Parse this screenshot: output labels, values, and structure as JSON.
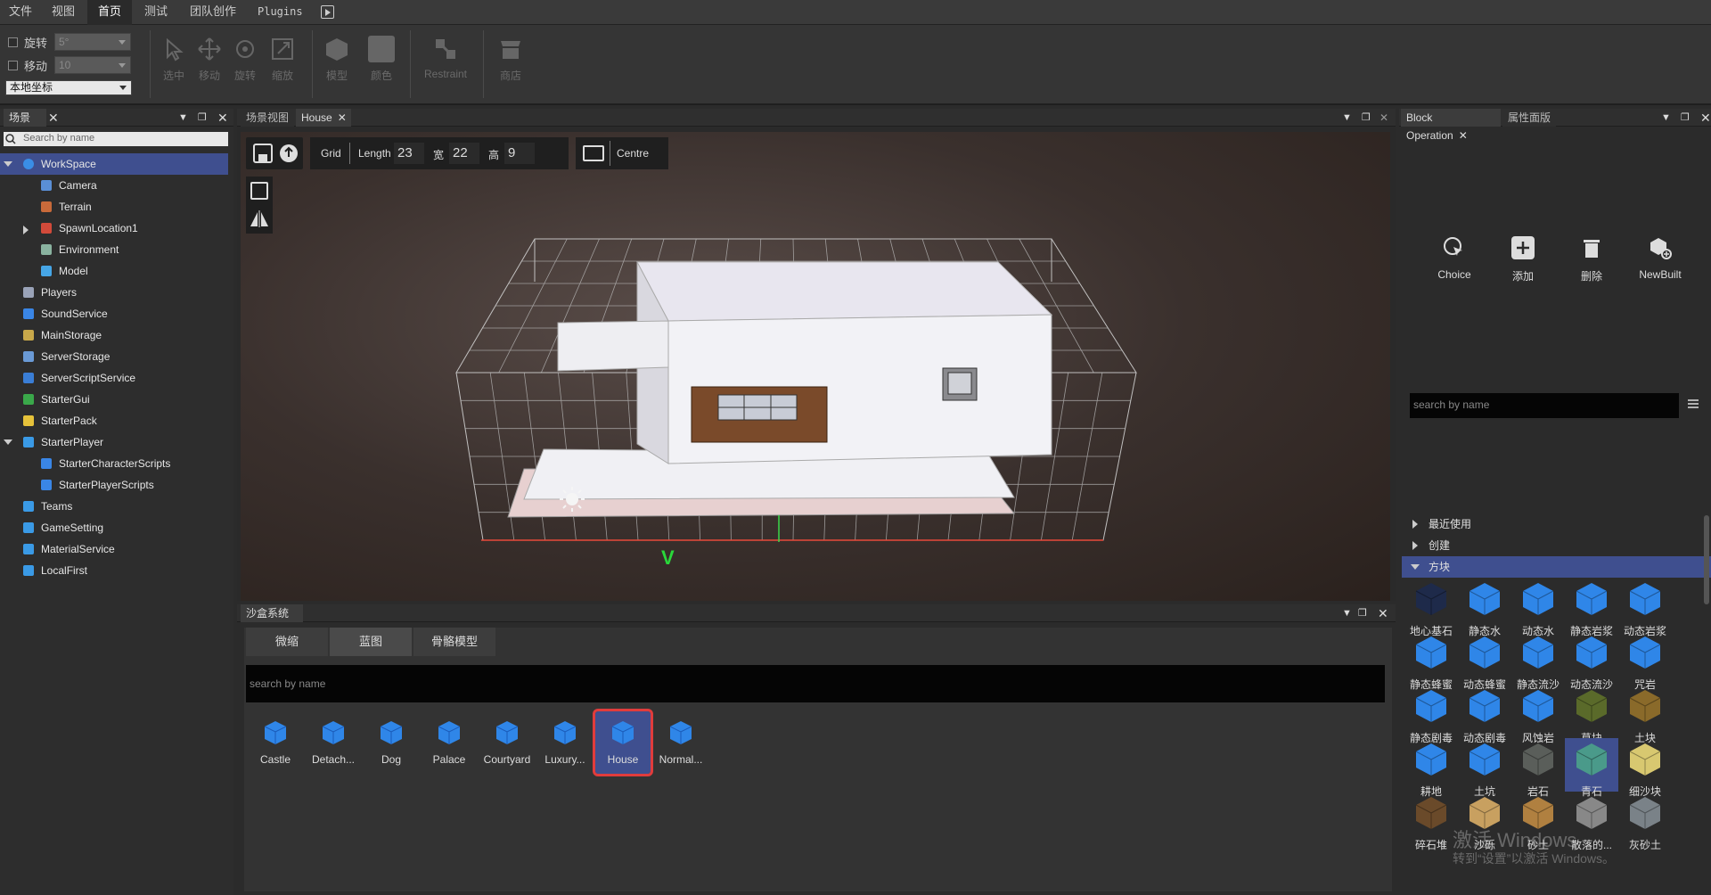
{
  "menubar": {
    "items": [
      "文件",
      "视图",
      "首页",
      "测试",
      "团队创作",
      "Plugins"
    ],
    "active_index": 2
  },
  "toolbar": {
    "rotate_label": "旋转",
    "rotate_value": "5°",
    "move_label": "移动",
    "move_value": "10",
    "coord_mode": "本地坐标",
    "buttons": [
      "选中",
      "移动",
      "旋转",
      "缩放",
      "模型",
      "颜色",
      "Restraint",
      "商店"
    ]
  },
  "scene_panel": {
    "tab_label": "场景",
    "search_placeholder": "Search by name",
    "tree": [
      {
        "label": "WorkSpace",
        "icon": "globe-icon",
        "color": "#3a8ee6",
        "selected": true,
        "expanded": true
      },
      {
        "label": "Camera",
        "icon": "camera-icon",
        "color": "#5a8fd6"
      },
      {
        "label": "Terrain",
        "icon": "terrain-icon",
        "color": "#c86a3a"
      },
      {
        "label": "SpawnLocation1",
        "icon": "spawn-icon",
        "color": "#d24a3a",
        "collapsed": true
      },
      {
        "label": "Environment",
        "icon": "environment-icon",
        "color": "#8ab3a0"
      },
      {
        "label": "Model",
        "icon": "model-icon",
        "color": "#46a6e6"
      },
      {
        "label": "Players",
        "icon": "players-icon",
        "color": "#9aa3b8"
      },
      {
        "label": "SoundService",
        "icon": "sound-icon",
        "color": "#3a86e6"
      },
      {
        "label": "MainStorage",
        "icon": "storage-icon",
        "color": "#c8a84a"
      },
      {
        "label": "ServerStorage",
        "icon": "server-storage-icon",
        "color": "#6a9ad6"
      },
      {
        "label": "ServerScriptService",
        "icon": "script-service-icon",
        "color": "#3a7ed6"
      },
      {
        "label": "StarterGui",
        "icon": "gui-icon",
        "color": "#3aa84a"
      },
      {
        "label": "StarterPack",
        "icon": "pack-icon",
        "color": "#e6c23a"
      },
      {
        "label": "StarterPlayer",
        "icon": "player-icon",
        "color": "#3a9ae6",
        "expanded": true
      },
      {
        "label": "StarterCharacterScripts",
        "icon": "character-scripts-icon",
        "color": "#3a86e6"
      },
      {
        "label": "StarterPlayerScripts",
        "icon": "player-scripts-icon",
        "color": "#3a86e6"
      },
      {
        "label": "Teams",
        "icon": "teams-icon",
        "color": "#3a9ae6"
      },
      {
        "label": "GameSetting",
        "icon": "settings-icon",
        "color": "#3a9ae6"
      },
      {
        "label": "MaterialService",
        "icon": "material-icon",
        "color": "#3a9ae6"
      },
      {
        "label": "LocalFirst",
        "icon": "local-icon",
        "color": "#3a9ae6"
      }
    ]
  },
  "editor": {
    "tabs": [
      "场景视图",
      "House"
    ],
    "grid_label": "Grid",
    "length_label": "Length",
    "length_value": "23",
    "width_label": "宽",
    "width_value": "22",
    "height_label": "高",
    "height_value": "9",
    "centre_label": "Centre",
    "axis_marker": "V"
  },
  "sandbox": {
    "tab_label": "沙盒系统",
    "subtabs": [
      "微缩",
      "蓝图",
      "骨骼模型"
    ],
    "search_placeholder": "search by name",
    "assets": [
      "Castle",
      "Detach...",
      "Dog",
      "Palace",
      "Courtyard",
      "Luxury...",
      "House",
      "Normal..."
    ],
    "selected_asset": "House"
  },
  "block_panel": {
    "tabs": [
      "Block Operation",
      "属性面版"
    ],
    "operations": [
      "Choice",
      "添加",
      "删除",
      "NewBuilt"
    ],
    "search_placeholder": "search by name",
    "categories": [
      "最近使用",
      "创建",
      "方块"
    ],
    "blocks": [
      {
        "label": "地心基石",
        "color": "#1e2a4a"
      },
      {
        "label": "静态水",
        "color": "#2f86e8"
      },
      {
        "label": "动态水",
        "color": "#2f86e8"
      },
      {
        "label": "静态岩浆",
        "color": "#2f86e8"
      },
      {
        "label": "动态岩浆",
        "color": "#2f86e8"
      },
      {
        "label": "静态蜂蜜",
        "color": "#2f86e8"
      },
      {
        "label": "动态蜂蜜",
        "color": "#2f86e8"
      },
      {
        "label": "静态流沙",
        "color": "#2f86e8"
      },
      {
        "label": "动态流沙",
        "color": "#2f86e8"
      },
      {
        "label": "咒岩",
        "color": "#2f86e8"
      },
      {
        "label": "静态剧毒",
        "color": "#2f86e8"
      },
      {
        "label": "动态剧毒",
        "color": "#2f86e8"
      },
      {
        "label": "风蚀岩",
        "color": "#2f86e8"
      },
      {
        "label": "草块",
        "color": "#5a6a2a"
      },
      {
        "label": "土块",
        "color": "#8a6a2a"
      },
      {
        "label": "耕地",
        "color": "#2f86e8"
      },
      {
        "label": "土坑",
        "color": "#2f86e8"
      },
      {
        "label": "岩石",
        "color": "#5a5e5a"
      },
      {
        "label": "青石",
        "color": "#4a9a8a",
        "selected": true
      },
      {
        "label": "细沙块",
        "color": "#d8c870"
      },
      {
        "label": "碎石堆",
        "color": "#6a4a2a"
      },
      {
        "label": "沙砾",
        "color": "#c8a060"
      },
      {
        "label": "砂土",
        "color": "#b08040"
      },
      {
        "label": "散落的...",
        "color": "#888888"
      },
      {
        "label": "灰砂土",
        "color": "#7a8288"
      }
    ],
    "watermark_line1": "激活 Windows",
    "watermark_line2": "转到“设置”以激活 Windows。"
  },
  "colors": {
    "accent": "#3f4f8f",
    "selection_outline": "#e03c3c",
    "cube_blue": "#2f86e8"
  }
}
